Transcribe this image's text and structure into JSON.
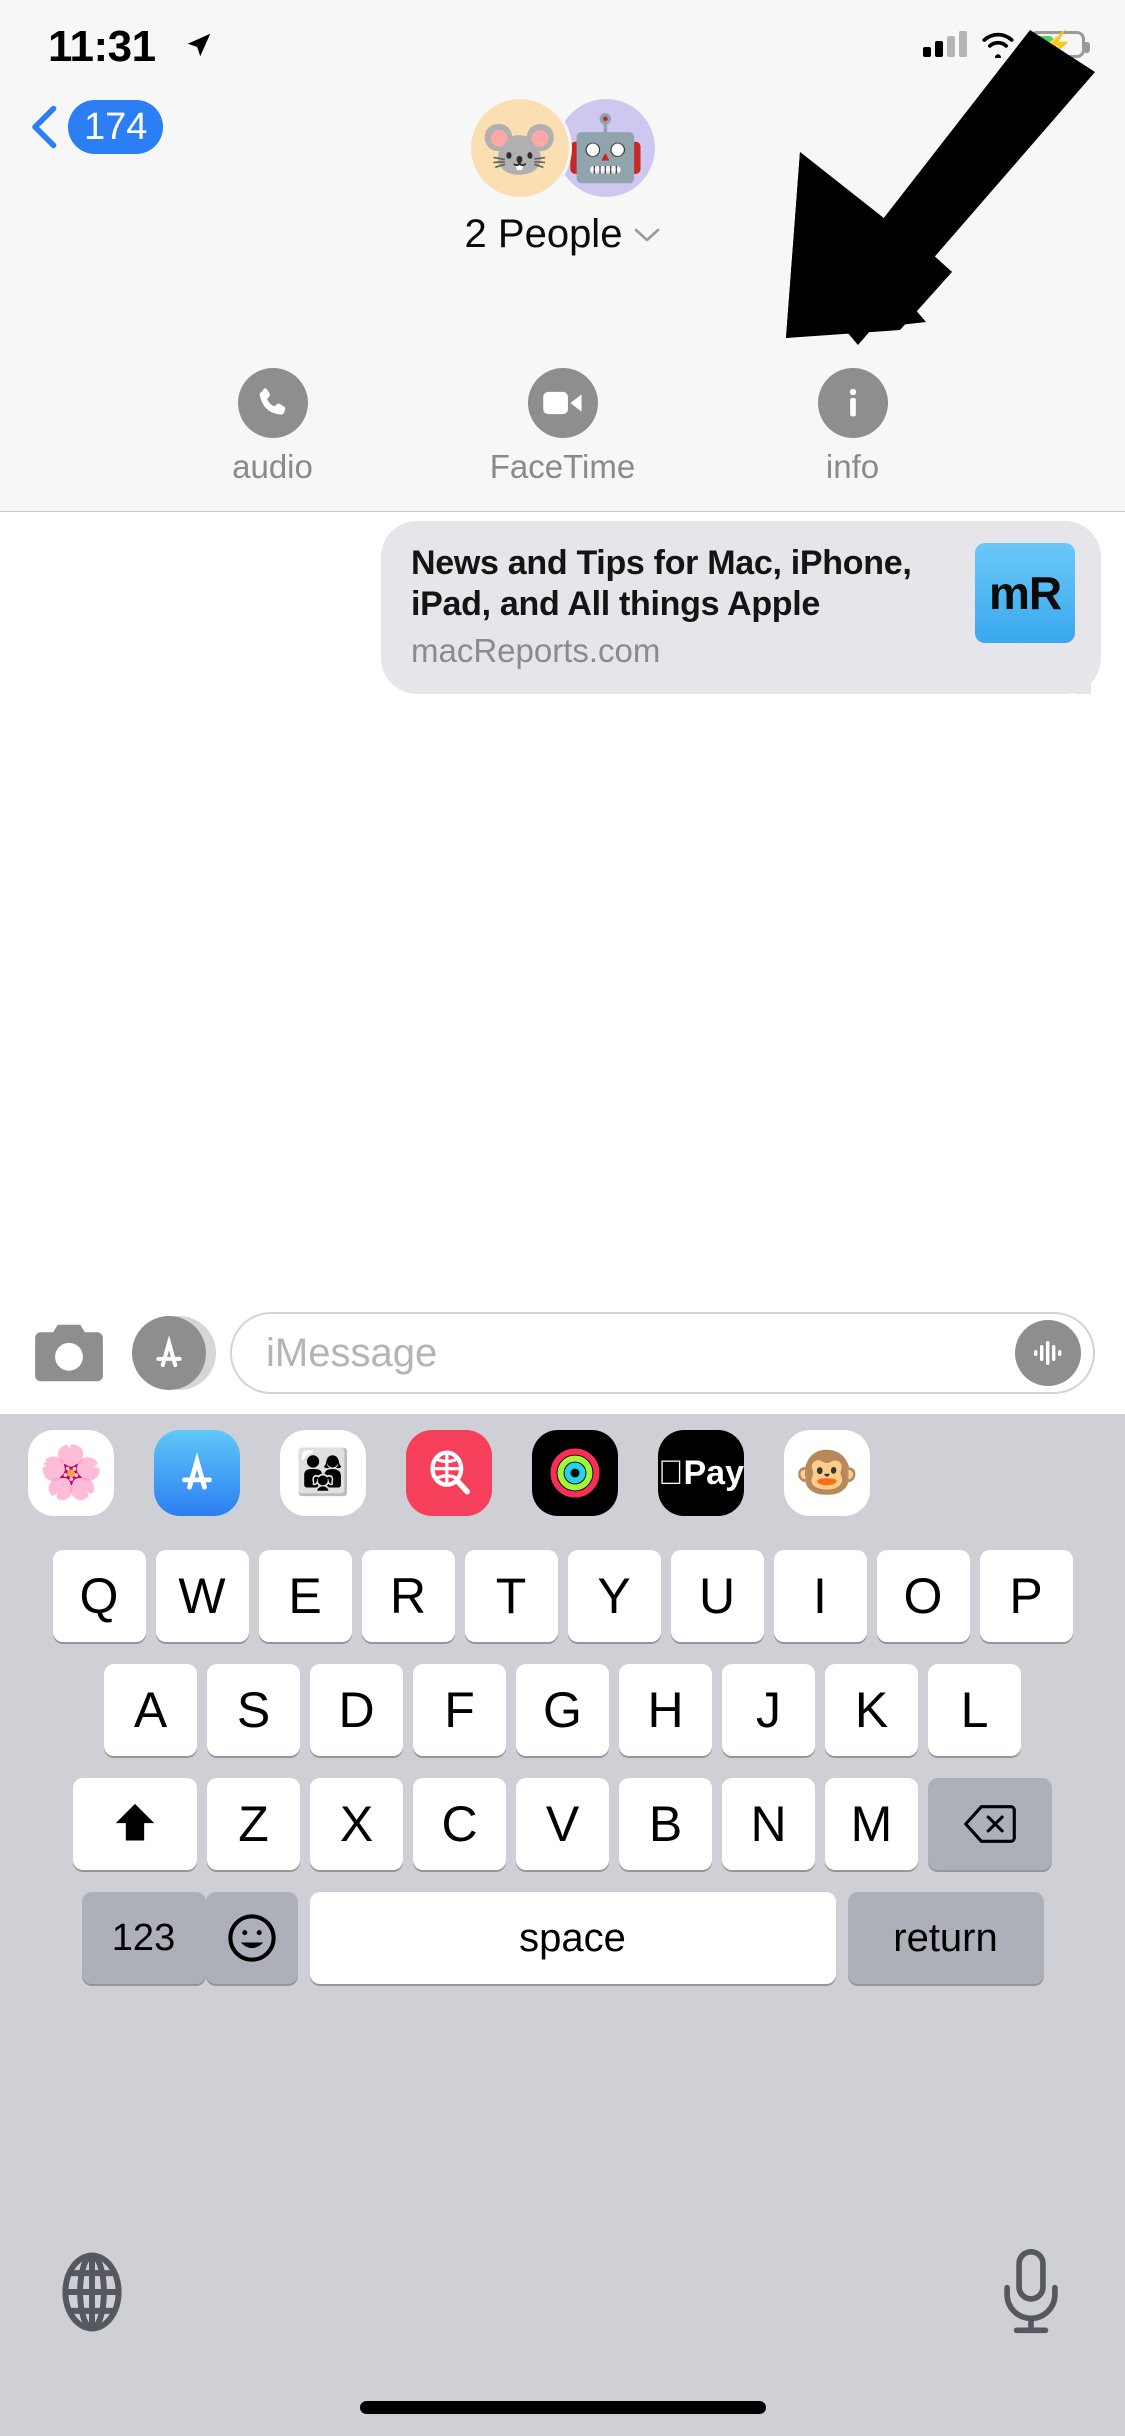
{
  "status_bar": {
    "time": "11:31",
    "location_icon": "location-arrow-icon",
    "signal_icon": "cellular-signal-icon",
    "signal_bars_filled": 2,
    "signal_bars_total": 4,
    "wifi_icon": "wifi-icon",
    "battery_icon": "battery-charging-icon",
    "battery_level_percent": 40,
    "battery_charging": true,
    "colors": {
      "battery_green": "#4cd25f",
      "accent_blue": "#2b7ef3"
    }
  },
  "header": {
    "back_button": {
      "icon": "chevron-left-icon",
      "badge": "174"
    },
    "avatars": [
      {
        "name": "mouse-memoji-avatar",
        "glyph": "🐭",
        "background": "#fadfb2"
      },
      {
        "name": "robot-memoji-avatar",
        "glyph": "🤖",
        "background": "#cfc7f0"
      }
    ],
    "group_title": "2 People",
    "group_chevron": "chevron-down-icon",
    "actions": [
      {
        "name": "audio-call-button",
        "label": "audio",
        "icon": "phone-icon"
      },
      {
        "name": "facetime-button",
        "label": "FaceTime",
        "icon": "video-camera-icon"
      },
      {
        "name": "info-button",
        "label": "info",
        "icon": "info-circle-icon"
      }
    ]
  },
  "conversation": {
    "message": {
      "title": "News and Tips for Mac, iPhone, iPad, and All things Apple",
      "domain": "macReports.com",
      "thumbnail_text": "mR",
      "bubble_color": "#e6e5ea"
    }
  },
  "input_bar": {
    "camera_icon": "camera-icon",
    "appstore_icon": "app-store-icon",
    "placeholder": "iMessage",
    "value": "",
    "audio_icon": "audio-waveform-icon"
  },
  "app_drawer": [
    {
      "name": "app-photos",
      "icon": "photos-icon",
      "glyph": "🌸"
    },
    {
      "name": "app-store",
      "icon": "app-store-icon",
      "glyph": ""
    },
    {
      "name": "app-memoji",
      "icon": "memoji-stickers-icon",
      "glyph": "👨‍👩‍👧"
    },
    {
      "name": "app-music",
      "icon": "music-search-icon",
      "glyph": ""
    },
    {
      "name": "app-activity",
      "icon": "activity-rings-icon",
      "glyph": ""
    },
    {
      "name": "app-apple-pay",
      "icon": "apple-pay-icon",
      "glyph": "Pay"
    },
    {
      "name": "app-monkey-memoji",
      "icon": "monkey-memoji-icon",
      "glyph": "🐵"
    }
  ],
  "keyboard": {
    "row1": [
      "Q",
      "W",
      "E",
      "R",
      "T",
      "Y",
      "U",
      "I",
      "O",
      "P"
    ],
    "row2": [
      "A",
      "S",
      "D",
      "F",
      "G",
      "H",
      "J",
      "K",
      "L"
    ],
    "row3_letters": [
      "Z",
      "X",
      "C",
      "V",
      "B",
      "N",
      "M"
    ],
    "shift_icon": "shift-arrow-icon",
    "delete_icon": "backspace-icon",
    "numbers_key": "123",
    "emoji_key_icon": "smiley-face-icon",
    "space_key": "space",
    "return_key": "return",
    "globe_icon": "globe-icon",
    "dictation_icon": "microphone-icon"
  },
  "annotation": {
    "arrow": "black-pointer-arrow",
    "points_at": "info-button"
  }
}
